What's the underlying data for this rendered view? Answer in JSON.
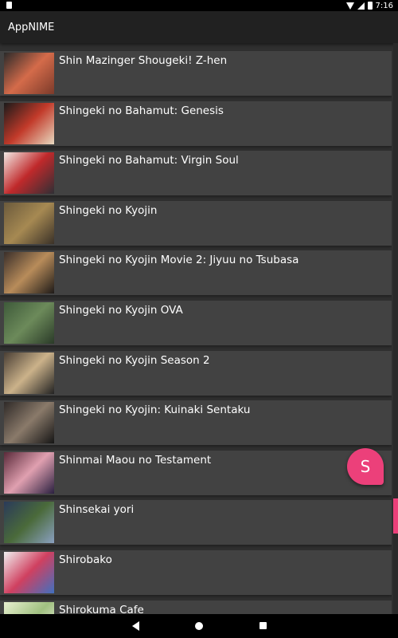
{
  "status_bar": {
    "time": "7:16"
  },
  "app": {
    "title": "AppNIME"
  },
  "anime_list": [
    {
      "title": "Shin Mazinger Shougeki! Z-hen",
      "colors": [
        "#2a2a2a",
        "#d46b4a",
        "#7b3a2a"
      ]
    },
    {
      "title": "Shingeki no Bahamut: Genesis",
      "colors": [
        "#1a1a1a",
        "#c23a2a",
        "#e8d9c0"
      ]
    },
    {
      "title": "Shingeki no Bahamut: Virgin Soul",
      "colors": [
        "#f2e9e4",
        "#c0292b",
        "#2f2f35"
      ]
    },
    {
      "title": "Shingeki no Kyojin",
      "colors": [
        "#6b5a3c",
        "#a68952",
        "#3a3128"
      ]
    },
    {
      "title": "Shingeki no Kyojin Movie 2: Jiyuu no Tsubasa",
      "colors": [
        "#3a2f2a",
        "#b88c5a",
        "#1e1a18"
      ]
    },
    {
      "title": "Shingeki no Kyojin OVA",
      "colors": [
        "#3e5a3a",
        "#6c8a5a",
        "#2a3a28"
      ]
    },
    {
      "title": "Shingeki no Kyojin Season 2",
      "colors": [
        "#4a3f35",
        "#cbb28a",
        "#222222"
      ]
    },
    {
      "title": "Shingeki no Kyojin: Kuinaki Sentaku",
      "colors": [
        "#2f2a28",
        "#8a7a6a",
        "#151515"
      ]
    },
    {
      "title": "Shinmai Maou no Testament",
      "colors": [
        "#5a2a3a",
        "#e0a0b0",
        "#2a2040"
      ]
    },
    {
      "title": "Shinsekai yori",
      "colors": [
        "#2a3a5a",
        "#4a6a3a",
        "#8aa0c0"
      ]
    },
    {
      "title": "Shirobako",
      "colors": [
        "#f0f0f0",
        "#d04060",
        "#4070c0"
      ]
    },
    {
      "title": "Shirokuma Cafe",
      "colors": [
        "#e8f0d0",
        "#a0c080",
        "#f8f8f0"
      ]
    }
  ],
  "fab": {
    "label": "S",
    "color": "#ec407a"
  },
  "scroll": {
    "position_fraction": 0.85
  }
}
